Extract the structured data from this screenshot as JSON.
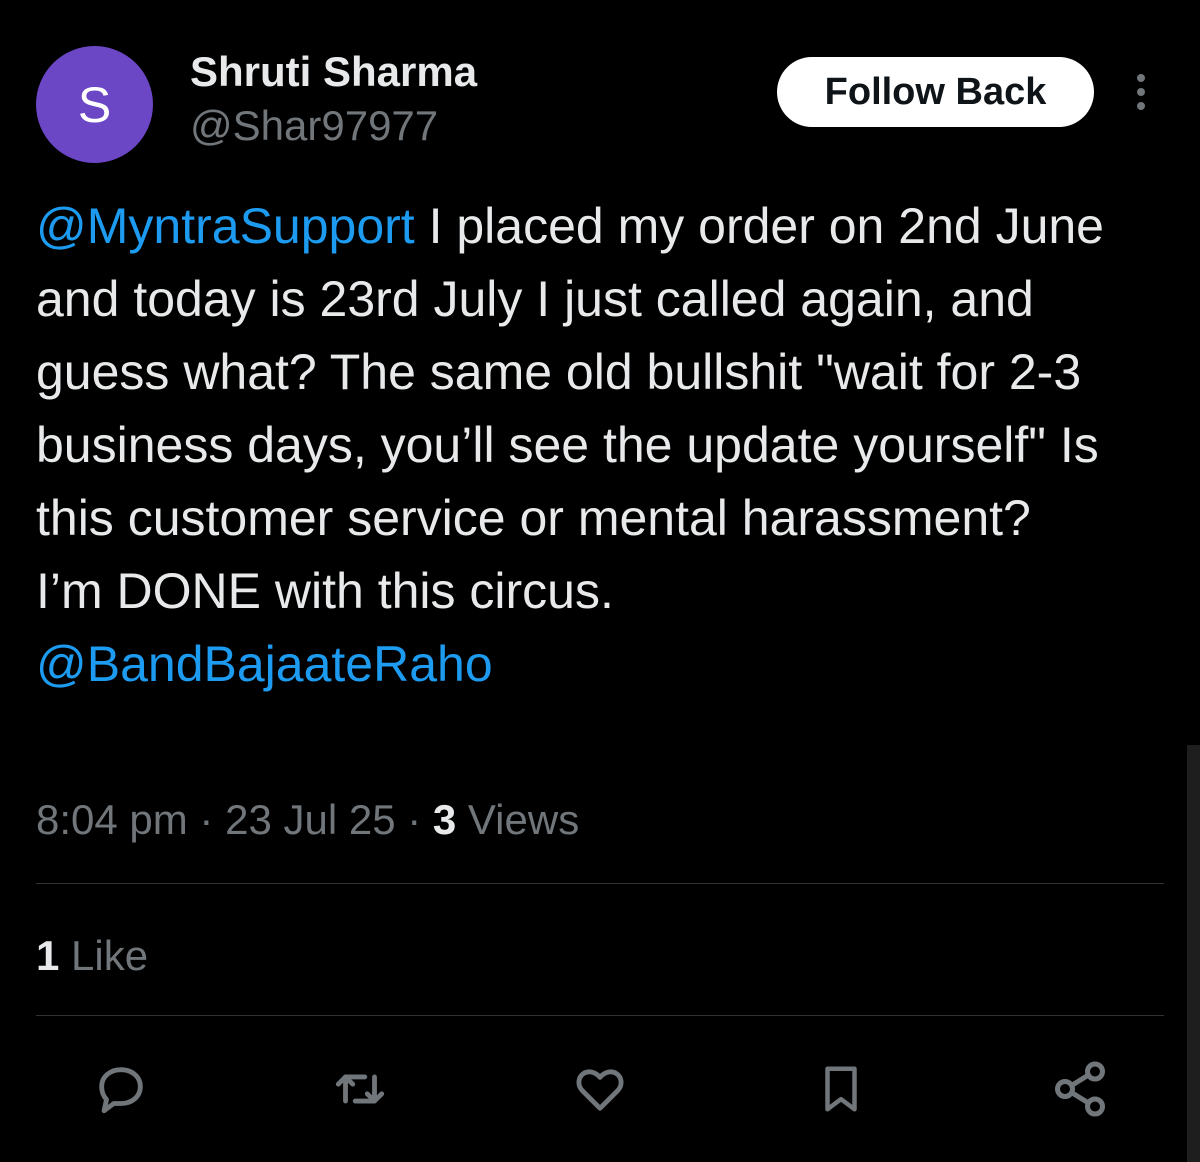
{
  "author": {
    "avatar_letter": "S",
    "avatar_color": "#6b47c6",
    "display_name": "Shruti Sharma",
    "handle": "@Shar97977"
  },
  "header": {
    "follow_label": "Follow Back",
    "more_icon": "more-vertical-icon"
  },
  "tweet": {
    "mention_1": "@MyntraSupport",
    "body": " I placed my order on 2nd June and today is 23rd July I just called again, and guess what? The same old bullshit \"wait for 2-3 business days, you’ll see the update yourself\" Is this customer service or mental harassment?\nI’m DONE with this circus.\n",
    "mention_2": "@BandBajaateRaho"
  },
  "meta": {
    "time": "8:04 pm",
    "sep1": " · ",
    "date": "23 Jul 25",
    "sep2": " · ",
    "views_count": "3",
    "views_label": " Views"
  },
  "stats": {
    "likes_count": "1",
    "likes_label": " Like"
  },
  "actions": {
    "reply_icon": "reply-icon",
    "retweet_icon": "retweet-icon",
    "like_icon": "heart-icon",
    "bookmark_icon": "bookmark-icon",
    "share_icon": "share-icon"
  },
  "colors": {
    "background": "#000000",
    "text": "#e7e9ea",
    "secondary": "#71767b",
    "link": "#1d9bf0",
    "divider": "#2f3336"
  }
}
